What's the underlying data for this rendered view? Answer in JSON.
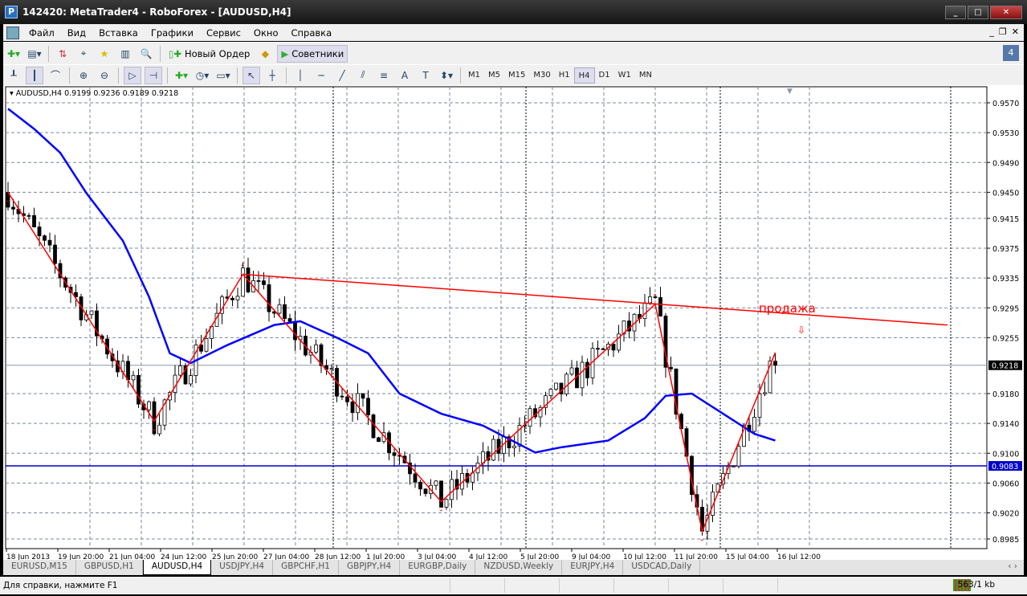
{
  "window": {
    "title": "142420: MetaTrader4 - RoboForex - [AUDUSD,H4]",
    "logo": "P"
  },
  "menu": [
    "Файл",
    "Вид",
    "Вставка",
    "Графики",
    "Сервис",
    "Окно",
    "Справка"
  ],
  "toolbar": {
    "new_order": "Новый Ордер",
    "experts": "Советники",
    "timeframes": [
      "M1",
      "M5",
      "M15",
      "M30",
      "H1",
      "H4",
      "D1",
      "W1",
      "MN"
    ],
    "active_timeframe": "H4",
    "notifications": "4"
  },
  "chart": {
    "symbol_header": "AUDUSD,H4  0.9199 0.9236 0.9189 0.9218",
    "price_axis": [
      "0.9570",
      "0.9530",
      "0.9490",
      "0.9450",
      "0.9415",
      "0.9375",
      "0.9335",
      "0.9295",
      "0.9255",
      "0.9180",
      "0.9140",
      "0.9100",
      "0.9060",
      "0.9020",
      "0.8985"
    ],
    "current_price": "0.9218",
    "hline_price": "0.9083",
    "time_axis": [
      "18 Jun 2013",
      "19 Jun 20:00",
      "21 Jun 04:00",
      "24 Jun 12:00",
      "25 Jun 20:00",
      "27 Jun 04:00",
      "28 Jun 12:00",
      "1 Jul 20:00",
      "3 Jul 04:00",
      "4 Jul 12:00",
      "5 Jul 20:00",
      "9 Jul 04:00",
      "10 Jul 12:00",
      "11 Jul 20:00",
      "15 Jul 04:00",
      "16 Jul 12:00"
    ],
    "zigzag": [
      [
        0,
        0.945
      ],
      [
        28,
        0.9143
      ],
      [
        45,
        0.934
      ],
      [
        83,
        0.9035
      ],
      [
        124,
        0.93
      ],
      [
        133,
        0.8995
      ],
      [
        147,
        0.9235
      ]
    ],
    "trendline": [
      [
        45,
        0.934
      ],
      [
        180,
        0.9272
      ]
    ],
    "ma": [
      [
        0,
        0.9562
      ],
      [
        5,
        0.9535
      ],
      [
        10,
        0.9503
      ],
      [
        15,
        0.9449
      ],
      [
        22,
        0.9385
      ],
      [
        27,
        0.931
      ],
      [
        31,
        0.9234
      ],
      [
        35,
        0.9221
      ],
      [
        42,
        0.9245
      ],
      [
        51,
        0.9272
      ],
      [
        56,
        0.9277
      ],
      [
        63,
        0.9255
      ],
      [
        69,
        0.9234
      ],
      [
        75,
        0.918
      ],
      [
        83,
        0.9153
      ],
      [
        91,
        0.9137
      ],
      [
        101,
        0.9101
      ],
      [
        106,
        0.9108
      ],
      [
        115,
        0.9117
      ],
      [
        122,
        0.9147
      ],
      [
        126,
        0.9177
      ],
      [
        131,
        0.918
      ],
      [
        137,
        0.9153
      ],
      [
        143,
        0.9126
      ],
      [
        147,
        0.9117
      ]
    ],
    "annotation": "продажа",
    "colors": {
      "zigzag": "#ff0000",
      "ma": "#0000ff",
      "hline": "#0000cc"
    }
  },
  "tabs": [
    "EURUSD,M15",
    "GBPUSD,H1",
    "AUDUSD,H4",
    "USDJPY,H4",
    "GBPCHF,H1",
    "GBPJPY,H4",
    "EURGBP,Daily",
    "NZDUSD,Weekly",
    "EURJPY,H4",
    "USDCAD,Daily"
  ],
  "active_tab": "AUDUSD,H4",
  "status": {
    "help": "Для справки, нажмите F1",
    "traffic": "563/1 kb"
  }
}
